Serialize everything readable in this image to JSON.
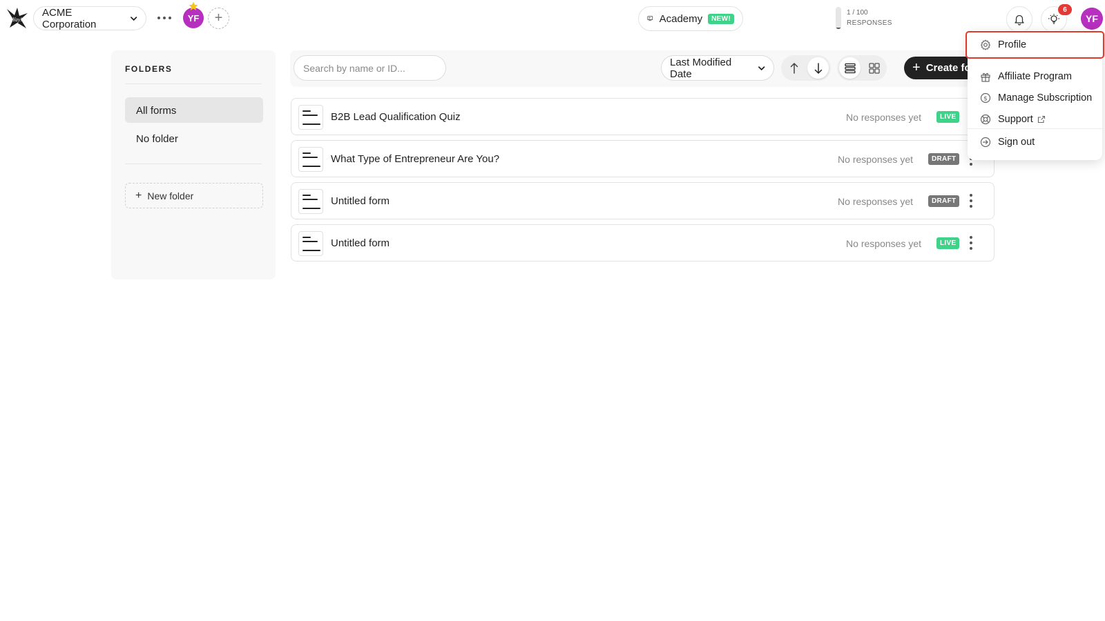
{
  "header": {
    "workspace_name": "ACME Corporation",
    "member_initials": "YF",
    "academy_label": "Academy",
    "academy_badge": "NEW!",
    "responses_count": "1 / 100",
    "responses_label": "RESPONSES",
    "responses_fraction": 0.01,
    "notifications_count": "6",
    "user_initials": "YF"
  },
  "sidebar": {
    "title": "FOLDERS",
    "items": [
      {
        "label": "All forms",
        "active": true
      },
      {
        "label": "No folder",
        "active": false
      }
    ],
    "new_folder_label": "New folder"
  },
  "toolbar": {
    "search_placeholder": "Search by name or ID...",
    "sort_value": "Last Modified Date",
    "create_label": "Create form"
  },
  "forms": [
    {
      "name": "B2B Lead Qualification Quiz",
      "responses": "No responses yet",
      "status": "LIVE"
    },
    {
      "name": "What Type of Entrepreneur Are You?",
      "responses": "No responses yet",
      "status": "DRAFT"
    },
    {
      "name": "Untitled form",
      "responses": "No responses yet",
      "status": "DRAFT"
    },
    {
      "name": "Untitled form",
      "responses": "No responses yet",
      "status": "LIVE"
    }
  ],
  "user_menu": {
    "items": [
      {
        "label": "Profile",
        "icon": "gear-icon"
      },
      {
        "label": "Affiliate Program",
        "icon": "gift-icon"
      },
      {
        "label": "Manage Subscription",
        "icon": "dollar-icon"
      },
      {
        "label": "Support",
        "icon": "lifebuoy-icon"
      },
      {
        "label": "Sign out",
        "icon": "sign-out-icon"
      }
    ]
  },
  "colors": {
    "avatar": "#b62fbe",
    "live": "#3fd38a",
    "draft": "#777777",
    "highlight": "#e23a2a",
    "notification": "#e53935"
  }
}
